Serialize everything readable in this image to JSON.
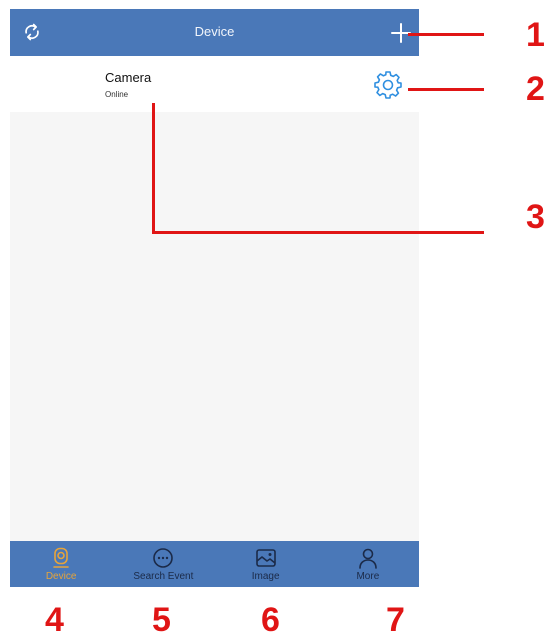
{
  "header": {
    "title": "Device",
    "refresh_icon": "refresh-icon",
    "add_icon": "plus-icon"
  },
  "device": {
    "name": "Camera",
    "status": "Online",
    "settings_icon": "gear-icon"
  },
  "tabs": [
    {
      "label": "Device",
      "icon": "camera-icon",
      "active": true
    },
    {
      "label": "Search Event",
      "icon": "chat-bubble-icon",
      "active": false
    },
    {
      "label": "Image",
      "icon": "image-icon",
      "active": false
    },
    {
      "label": "More",
      "icon": "user-icon",
      "active": false
    }
  ],
  "annotations": [
    "1",
    "2",
    "3",
    "4",
    "5",
    "6",
    "7"
  ],
  "colors": {
    "accent": "#4a78b8",
    "active_tab": "#e6a43a",
    "annotation": "#e01515"
  }
}
